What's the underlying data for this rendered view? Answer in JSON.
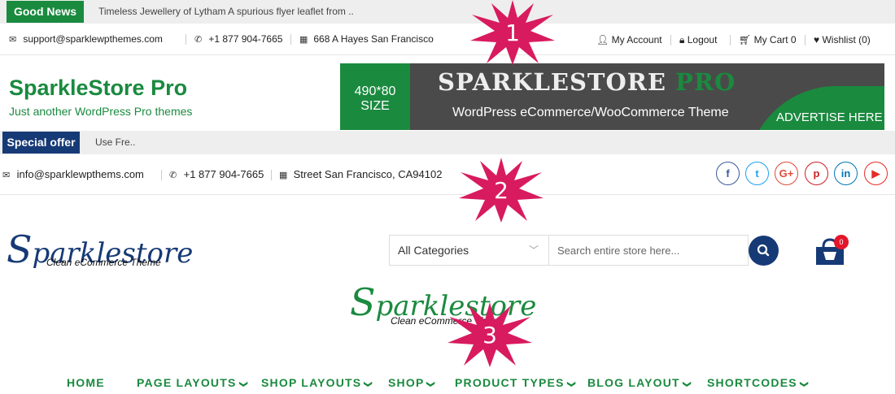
{
  "section1": {
    "news_label": "Good News",
    "news_ticker": "Timeless Jewellery of Lytham A spurious flyer leaflet from ..",
    "contact": {
      "email": "support@sparklewpthemes.com",
      "phone": "+1 877 904-7665",
      "address": "668 A Hayes San Francisco"
    },
    "account": {
      "my_account": "My Account",
      "logout": "Logout",
      "my_cart": "My Cart 0",
      "wishlist": "Wishlist (0)"
    },
    "site_title": "SparkleStore Pro",
    "tagline": "Just another WordPress Pro themes",
    "ad": {
      "size_line1": "490*80",
      "size_line2": "SIZE",
      "title_main": "SPARKLESTORE",
      "title_accent": "PRO",
      "subtitle": "WordPress eCommerce/WooCommerce Theme",
      "cta": "ADVERTISE HERE"
    },
    "marker_number": "1"
  },
  "section2": {
    "offer_label": "Special offer",
    "offer_ticker": "Use Fre..",
    "contact": {
      "email": "info@sparklewpthems.com",
      "phone": "+1 877 904-7665",
      "address": "Street San Francisco, CA94102"
    },
    "social": [
      {
        "icon": "facebook-icon",
        "glyph": "f",
        "color": "#3b5998"
      },
      {
        "icon": "twitter-icon",
        "glyph": "t",
        "color": "#1da1f2"
      },
      {
        "icon": "google-plus-icon",
        "glyph": "G+",
        "color": "#dd4b39"
      },
      {
        "icon": "pinterest-icon",
        "glyph": "p",
        "color": "#cb2027"
      },
      {
        "icon": "linkedin-icon",
        "glyph": "in",
        "color": "#0077b5"
      },
      {
        "icon": "youtube-icon",
        "glyph": "▶",
        "color": "#e52d27"
      }
    ],
    "logo_text_first": "S",
    "logo_text_rest": "parklestore",
    "logo_tagline": "Clean eCommerce Theme",
    "category_select": "All Categories",
    "search_placeholder": "Search entire store here...",
    "cart_count": "0",
    "marker_number": "2"
  },
  "section3": {
    "logo_text_first": "S",
    "logo_text_rest": "parklestore",
    "logo_tagline": "Clean eCommerce Theme",
    "nav": [
      {
        "label": "HOME",
        "has_dropdown": false
      },
      {
        "label": "PAGE LAYOUTS",
        "has_dropdown": true
      },
      {
        "label": "SHOP LAYOUTS",
        "has_dropdown": true
      },
      {
        "label": "SHOP",
        "has_dropdown": true
      },
      {
        "label": "PRODUCT TYPES",
        "has_dropdown": true
      },
      {
        "label": "BLOG LAYOUT",
        "has_dropdown": true
      },
      {
        "label": "SHORTCODES",
        "has_dropdown": true
      }
    ],
    "marker_number": "3"
  },
  "colors": {
    "green": "#1a8a3f",
    "navy": "#163a76",
    "burst": "#d81b5e",
    "badge": "#e3162a"
  }
}
